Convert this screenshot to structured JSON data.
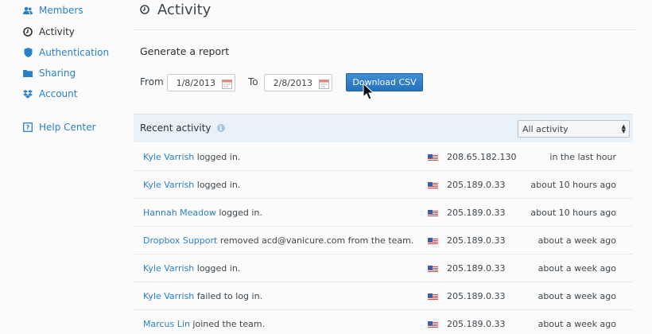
{
  "sidebar": {
    "items": [
      {
        "label": "Members",
        "icon": "members-icon"
      },
      {
        "label": "Activity",
        "icon": "clock-icon"
      },
      {
        "label": "Authentication",
        "icon": "shield-icon"
      },
      {
        "label": "Sharing",
        "icon": "folder-icon"
      },
      {
        "label": "Account",
        "icon": "dropbox-icon"
      }
    ],
    "help": {
      "label": "Help Center",
      "icon": "help-icon"
    }
  },
  "page": {
    "title": "Activity"
  },
  "report": {
    "heading": "Generate a report",
    "from_label": "From",
    "from_value": "1/8/2013",
    "to_label": "To",
    "to_value": "2/8/2013",
    "download_label": "Download CSV"
  },
  "activity": {
    "title": "Recent activity",
    "filter_value": "All activity",
    "rows": [
      {
        "user": "Kyle Varrish",
        "action": " logged in.",
        "ip": "208.65.182.130",
        "time": "in the last hour"
      },
      {
        "user": "Kyle Varrish",
        "action": " logged in.",
        "ip": "205.189.0.33",
        "time": "about 10 hours ago"
      },
      {
        "user": "Hannah Meadow",
        "action": " logged in.",
        "ip": "205.189.0.33",
        "time": "about 10 hours ago"
      },
      {
        "user": "Dropbox Support",
        "action": " removed acd@vanicure.com from the team.",
        "ip": "205.189.0.33",
        "time": "about a week ago"
      },
      {
        "user": "Kyle Varrish",
        "action": " logged in.",
        "ip": "205.189.0.33",
        "time": "about a week ago"
      },
      {
        "user": "Kyle Varrish",
        "action": " failed to log in.",
        "ip": "205.189.0.33",
        "time": "about a week ago"
      },
      {
        "user": "Marcus Lin",
        "action": " joined the team.",
        "ip": "205.189.0.33",
        "time": "about a week ago"
      }
    ]
  },
  "colors": {
    "accent": "#2a80c8",
    "button": "#2e7cc4",
    "panel_header": "#eaf2f9"
  }
}
